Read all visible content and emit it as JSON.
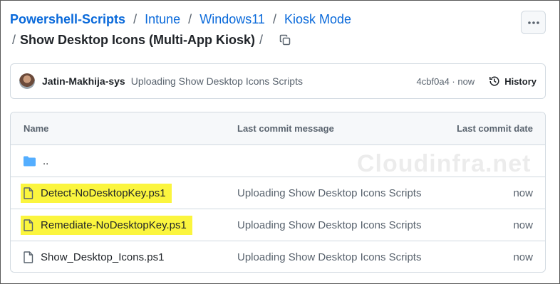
{
  "breadcrumb": {
    "root": "Powershell-Scripts",
    "parts": [
      "Intune",
      "Windows11",
      "Kiosk Mode"
    ],
    "separator": "/",
    "current": "Show Desktop Icons (Multi-App Kiosk)"
  },
  "commit": {
    "author": "Jatin-Makhija-sys",
    "message": "Uploading Show Desktop Icons Scripts",
    "sha": "4cbf0a4",
    "time": "now",
    "sha_time": "4cbf0a4 · now",
    "history_label": "History"
  },
  "table": {
    "headers": {
      "name": "Name",
      "message": "Last commit message",
      "date": "Last commit date"
    },
    "parent_dir": "..",
    "rows": [
      {
        "name": "Detect-NoDesktopKey.ps1",
        "message": "Uploading Show Desktop Icons Scripts",
        "date": "now",
        "highlighted": true
      },
      {
        "name": "Remediate-NoDesktopKey.ps1",
        "message": "Uploading Show Desktop Icons Scripts",
        "date": "now",
        "highlighted": true
      },
      {
        "name": "Show_Desktop_Icons.ps1",
        "message": "Uploading Show Desktop Icons Scripts",
        "date": "now",
        "highlighted": false
      }
    ]
  },
  "watermark": "Cloudinfra.net",
  "colors": {
    "link": "#0969da",
    "highlight": "#fbf53e",
    "folder": "#54aeff"
  }
}
